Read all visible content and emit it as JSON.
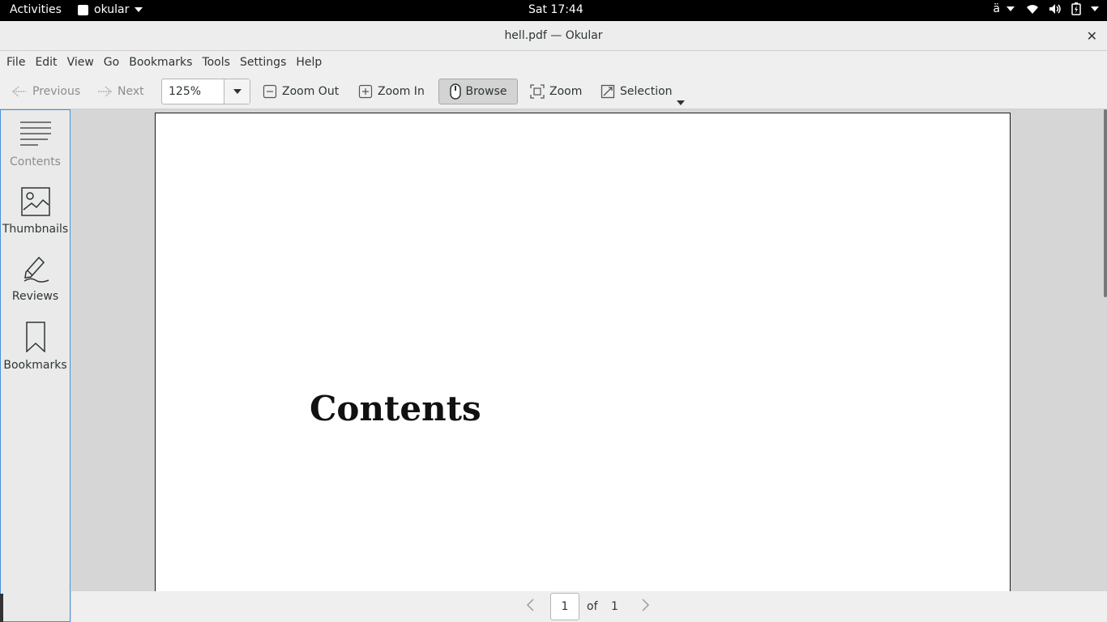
{
  "topbar": {
    "activities": "Activities",
    "app_name": "okular",
    "clock": "Sat 17:44",
    "input_method": "ä"
  },
  "window": {
    "title": "hell.pdf — Okular",
    "close_glyph": "✕"
  },
  "menubar": {
    "items": [
      "File",
      "Edit",
      "View",
      "Go",
      "Bookmarks",
      "Tools",
      "Settings",
      "Help"
    ]
  },
  "toolbar": {
    "previous": "Previous",
    "next": "Next",
    "zoom_value": "125%",
    "zoom_out": "Zoom Out",
    "zoom_in": "Zoom In",
    "browse": "Browse",
    "zoom": "Zoom",
    "selection": "Selection"
  },
  "sidebar": {
    "items": [
      {
        "label": "Contents",
        "icon": "contents-icon"
      },
      {
        "label": "Thumbnails",
        "icon": "thumbnails-icon"
      },
      {
        "label": "Reviews",
        "icon": "reviews-icon"
      },
      {
        "label": "Bookmarks",
        "icon": "bookmarks-icon"
      }
    ]
  },
  "document": {
    "heading": "Contents"
  },
  "pagebar": {
    "current_page": "1",
    "of_label": "of",
    "total_pages": "1"
  },
  "colors": {
    "accent": "#4a90d9",
    "topbar_bg": "#000000",
    "doc_bg": "#d6d6d6"
  }
}
